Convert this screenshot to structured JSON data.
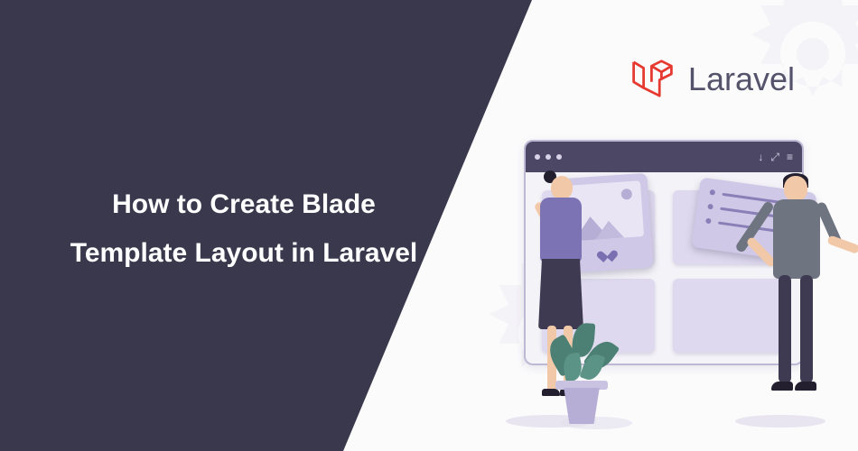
{
  "title_line1": "How to Create Blade",
  "title_line2": "Template Layout in Laravel",
  "brand": {
    "name": "Laravel"
  },
  "colors": {
    "left_bg": "#3a384d",
    "laravel_red": "#e6392f",
    "card_purple": "#cfc8e6",
    "accent_purple": "#7c73b5"
  }
}
